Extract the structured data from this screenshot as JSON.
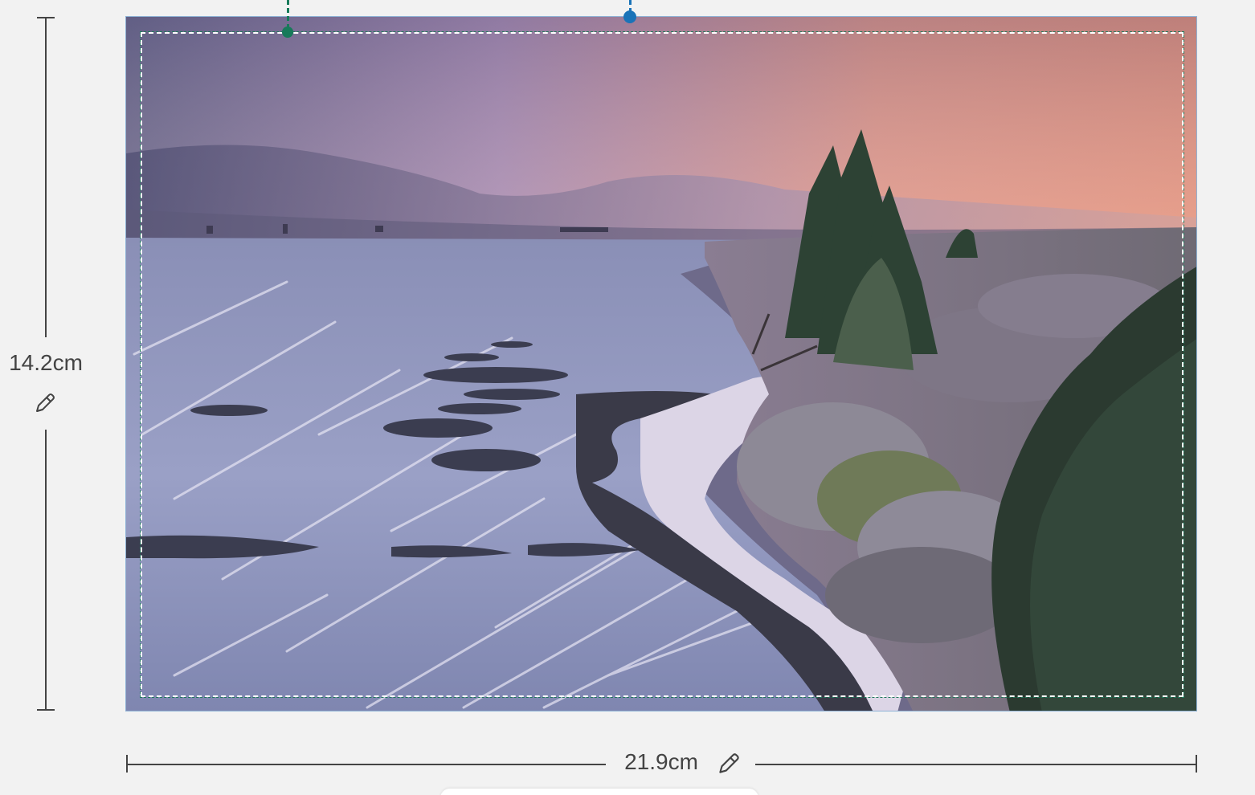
{
  "dimensions": {
    "height_label": "14.2cm",
    "width_label": "21.9cm"
  },
  "icons": {
    "height_edit": "pencil-icon",
    "width_edit": "pencil-icon"
  },
  "colors": {
    "safe_area_handle": "#177a5a",
    "bleed_handle": "#1a73b8",
    "ruler": "#444444",
    "background": "#f2f2f2",
    "photo_border": "#8fb3d6"
  }
}
